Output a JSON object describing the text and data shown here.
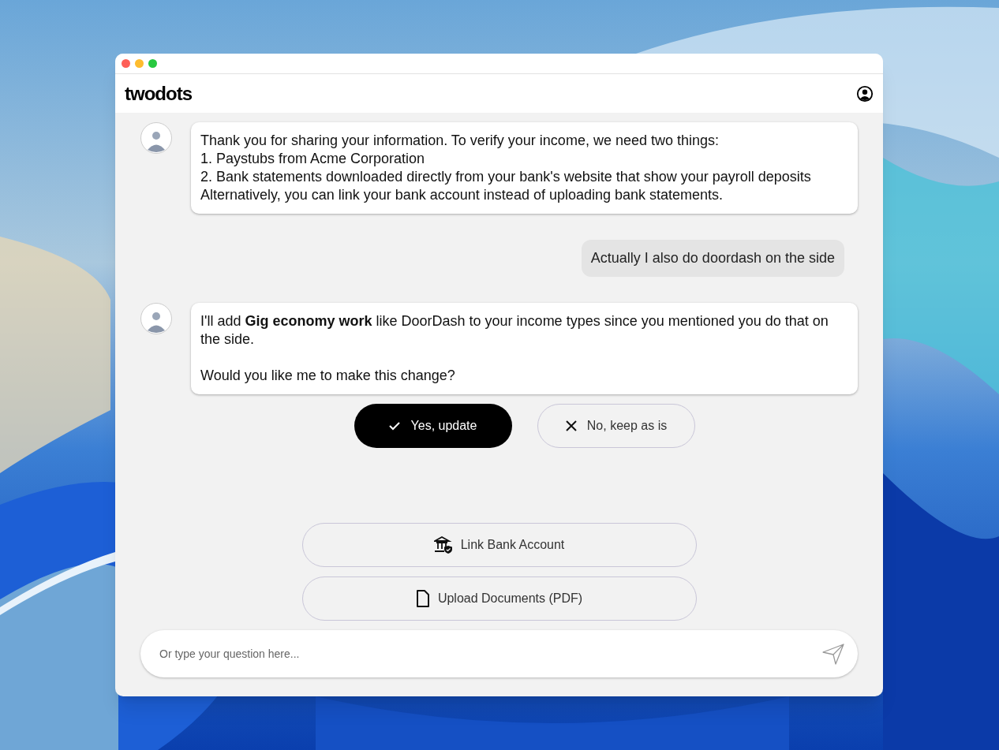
{
  "app": {
    "logo": "twodots"
  },
  "messages": [
    {
      "kind": "assistant",
      "paragraphs": [
        [
          "Thank you for sharing your information. To verify your income, we need two things:",
          "1. Paystubs from Acme Corporation",
          "2. Bank statements downloaded directly from your bank's website that show your payroll deposits",
          "Alternatively, you can link your bank account instead of uploading bank statements."
        ]
      ]
    },
    {
      "kind": "user",
      "paragraphs": [
        [
          "Actually I also do doordash on the side"
        ]
      ]
    },
    {
      "kind": "assistant",
      "paragraphs": [
        [
          "I'll add **Gig economy work** like DoorDash to your income types since you mentioned you do that on the side."
        ],
        [
          "Would you like me to make this change?"
        ]
      ]
    }
  ],
  "choices": [
    {
      "kind": "primary",
      "label": "Yes, update"
    },
    {
      "kind": "secondary",
      "label": "No, keep as is"
    }
  ],
  "actions": [
    {
      "kind": "bank",
      "label": "Link Bank Account"
    },
    {
      "kind": "document",
      "label": "Upload Documents (PDF)"
    }
  ],
  "input": {
    "placeholder": "Or type your question here..."
  }
}
